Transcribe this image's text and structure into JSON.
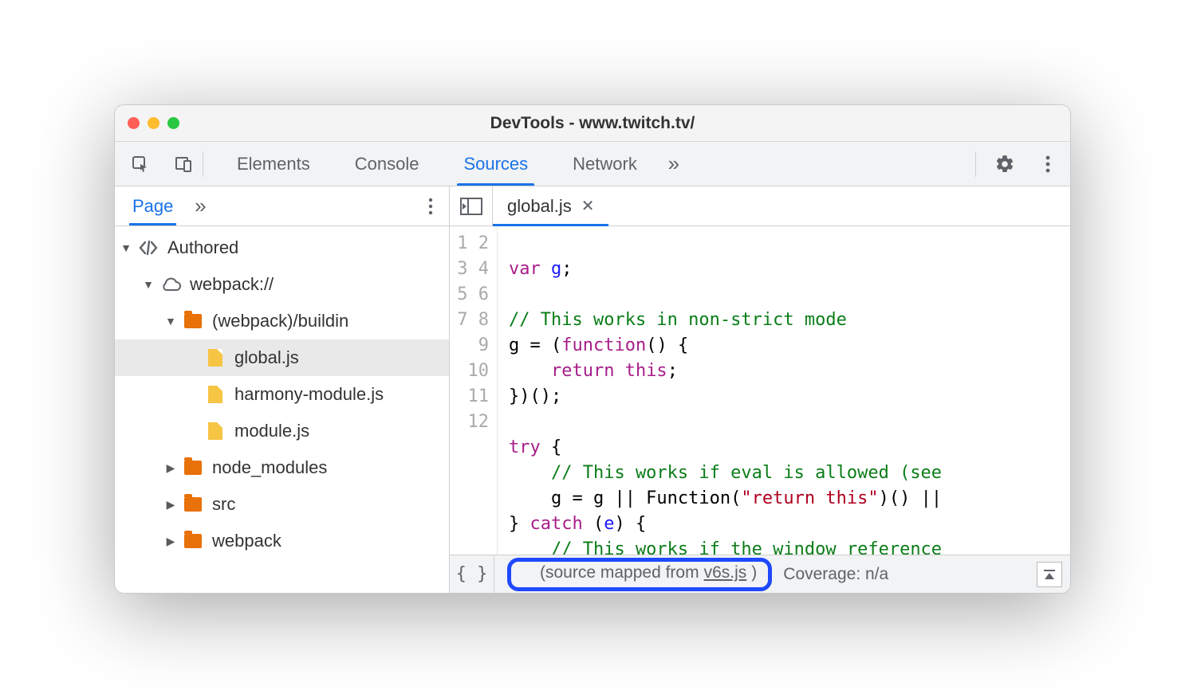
{
  "window": {
    "title": "DevTools - www.twitch.tv/"
  },
  "toolbar": {
    "tabs": [
      "Elements",
      "Console",
      "Sources",
      "Network"
    ],
    "active_tab": "Sources"
  },
  "sidebar": {
    "tabs": {
      "active": "Page"
    },
    "tree": {
      "root": {
        "label": "Authored",
        "expanded": true
      },
      "origin": {
        "label": "webpack://",
        "expanded": true
      },
      "folders": [
        {
          "label": "(webpack)/buildin",
          "expanded": true,
          "files": [
            "global.js",
            "harmony-module.js",
            "module.js"
          ],
          "selected_file": "global.js"
        },
        {
          "label": "node_modules",
          "expanded": false
        },
        {
          "label": "src",
          "expanded": false
        },
        {
          "label": "webpack",
          "expanded": false
        }
      ]
    }
  },
  "editor": {
    "open_file": "global.js",
    "line_count": 12,
    "lines": {
      "l1": {
        "a": "var ",
        "b": "g",
        "c": ";"
      },
      "l2": "",
      "l3": "// This works in non-strict mode",
      "l4": {
        "a": "g = (",
        "b": "function",
        "c": "() {"
      },
      "l5": {
        "a": "    ",
        "b": "return this",
        "c": ";"
      },
      "l6": "})();",
      "l7": "",
      "l8": {
        "a": "try",
        "b": " {"
      },
      "l9": "    // This works if eval is allowed (see",
      "l10": {
        "a": "    g = g || Function(",
        "b": "\"return this\"",
        "c": ")() ||"
      },
      "l11": {
        "a": "} ",
        "b": "catch",
        "c": " (",
        "d": "e",
        "e": ") {"
      },
      "l12": "    // This works if the window reference"
    }
  },
  "status": {
    "source_map_prefix": "(source mapped from ",
    "source_map_link": "v6s.js",
    "source_map_suffix": ")",
    "coverage": "Coverage: n/a"
  }
}
